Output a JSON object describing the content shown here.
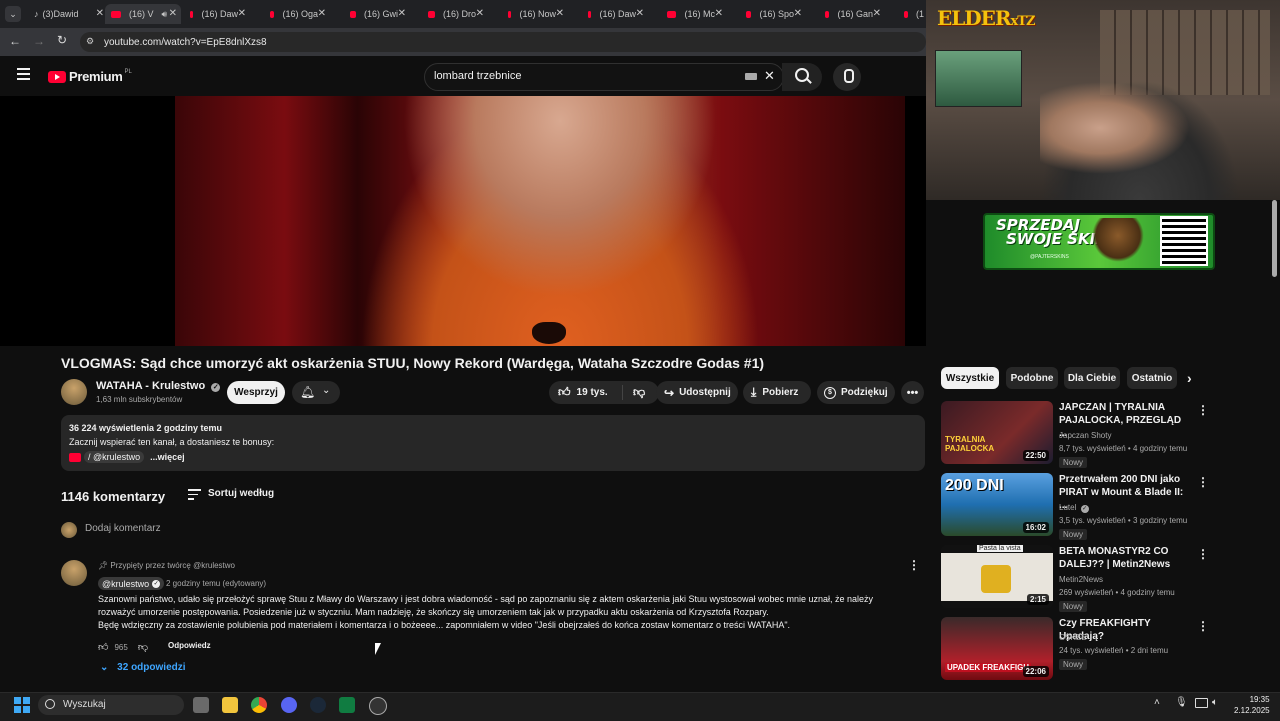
{
  "browser": {
    "tabs": [
      {
        "label": "(3)Dawid",
        "icon": "tiktok-icon"
      },
      {
        "label": "(16) V",
        "icon": "youtube-icon",
        "active": true
      },
      {
        "label": "(16) Daw",
        "icon": "youtube-icon"
      },
      {
        "label": "(16) Oga",
        "icon": "youtube-icon"
      },
      {
        "label": "(16) Gwi",
        "icon": "youtube-icon"
      },
      {
        "label": "(16) Dro",
        "icon": "youtube-icon"
      },
      {
        "label": "(16) Now",
        "icon": "youtube-icon"
      },
      {
        "label": "(16) Daw",
        "icon": "youtube-icon"
      },
      {
        "label": "(16) Mc",
        "icon": "youtube-icon"
      },
      {
        "label": "(16) Spo",
        "icon": "youtube-icon"
      },
      {
        "label": "(16) Gan",
        "icon": "youtube-icon"
      },
      {
        "label": "(1",
        "icon": "youtube-icon"
      }
    ],
    "url": "youtube.com/watch?v=EpE8dnlXzs8"
  },
  "youtube": {
    "logo_text": "Premium",
    "logo_region": "PL",
    "search_value": "lombard trzebnice"
  },
  "video": {
    "title": "VLOGMAS: Sąd chce umorzyć akt oskarżenia STUU, Nowy Rekord (Wardęga, Wataha Szczodre Godas #1)",
    "channel": "WATAHA - Krulestwo",
    "subscribers": "1,63 mln subskrybentów",
    "join_label": "Wesprzyj",
    "likes": "19 tys.",
    "share_label": "Udostępnij",
    "download_label": "Pobierz",
    "thanks_label": "Podziękuj",
    "description": {
      "stats": "36 224 wyświetlenia  2 godziny temu",
      "line2": "Zacznij wspierać ten kanał, a dostaniesz te bonusy:",
      "handle": "/ @krulestwo",
      "more": "...więcej"
    }
  },
  "comments": {
    "count": "1146 komentarzy",
    "sort_label": "Sortuj według",
    "add_placeholder": "Dodaj komentarz",
    "pinned": {
      "pinned_by": "Przypięty przez twórcę @krulestwo",
      "author": "@krulestwo",
      "time": "2 godziny temu (edytowany)",
      "text_line1": "Szanowni państwo, udało się przełożyć sprawę Stuu z Mławy do Warszawy i jest dobra wiadomość - sąd po zapoznaniu się z aktem oskarżenia jaki Stuu wystosował wobec mnie uznał, że należy",
      "text_line2": "rozważyć umorzenie postępowania. Posiedzenie już w styczniu. Mam nadzieję, że skończy się umorzeniem tak jak w przypadku aktu oskarżenia od Krzysztofa Rozpary.",
      "text_line3": "Będę wdzięczny za zostawienie polubienia pod materiałem i komentarza i o bożeeee... zapomniałem w video \"Jeśli obejrzałeś do końca zostaw komentarz o treści WATAHA\".",
      "likes": "965",
      "reply_label": "Odpowiedz",
      "replies_label": "32 odpowiedzi"
    }
  },
  "overlay": {
    "streamer_logo": "ELDER",
    "streamer_logo_suffix": "xTZ",
    "banner_line1": "SPRZEDAJ",
    "banner_line2": "SWOJE SKINY",
    "banner_small": "@PAJTERSKINS"
  },
  "sidebar": {
    "chips": [
      "Wszystkie",
      "Podobne",
      "Dla Ciebie",
      "Ostatnio"
    ],
    "recommendations": [
      {
        "title": "JAPCZAN | TYRALNIA PAJALOCKA, PRZEGLĄD ...",
        "channel": "Japczan Shoty",
        "meta": "8,7 tys. wyświetleń • 4 godziny temu",
        "badge": "Nowy",
        "duration": "22:50",
        "thumb_text": "TYRALNIA PAJALOCKA",
        "thumb_color": "#3a1a22"
      },
      {
        "title": "Przetrwałem 200 DNI jako PIRAT w Mount & Blade II: ...",
        "channel": "Lutel",
        "meta": "3,5 tys. wyświetleń • 3 godziny temu",
        "badge": "Nowy",
        "duration": "16:02",
        "thumb_text": "200 DNI",
        "thumb_color": "#1f6fb0"
      },
      {
        "title": "BETA MONASTYR2 CO DALEJ?? | Metin2News",
        "channel": "Metin2News",
        "meta": "269 wyświetleń • 4 godziny temu",
        "badge": "Nowy",
        "duration": "2:15",
        "thumb_text": "Pasta la vista",
        "thumb_color": "#e8e4dc"
      },
      {
        "title": "Czy FREAKFIGHTY Upadają?",
        "channel": "OSKEE",
        "meta": "24 tys. wyświetleń • 2 dni temu",
        "badge": "Nowy",
        "duration": "22:06",
        "thumb_text": "UPADEK FREAKFIGH",
        "thumb_color": "#b0202a"
      }
    ]
  },
  "taskbar": {
    "search_placeholder": "Wyszukaj",
    "time": "19:35",
    "date": "2.12.2025"
  }
}
